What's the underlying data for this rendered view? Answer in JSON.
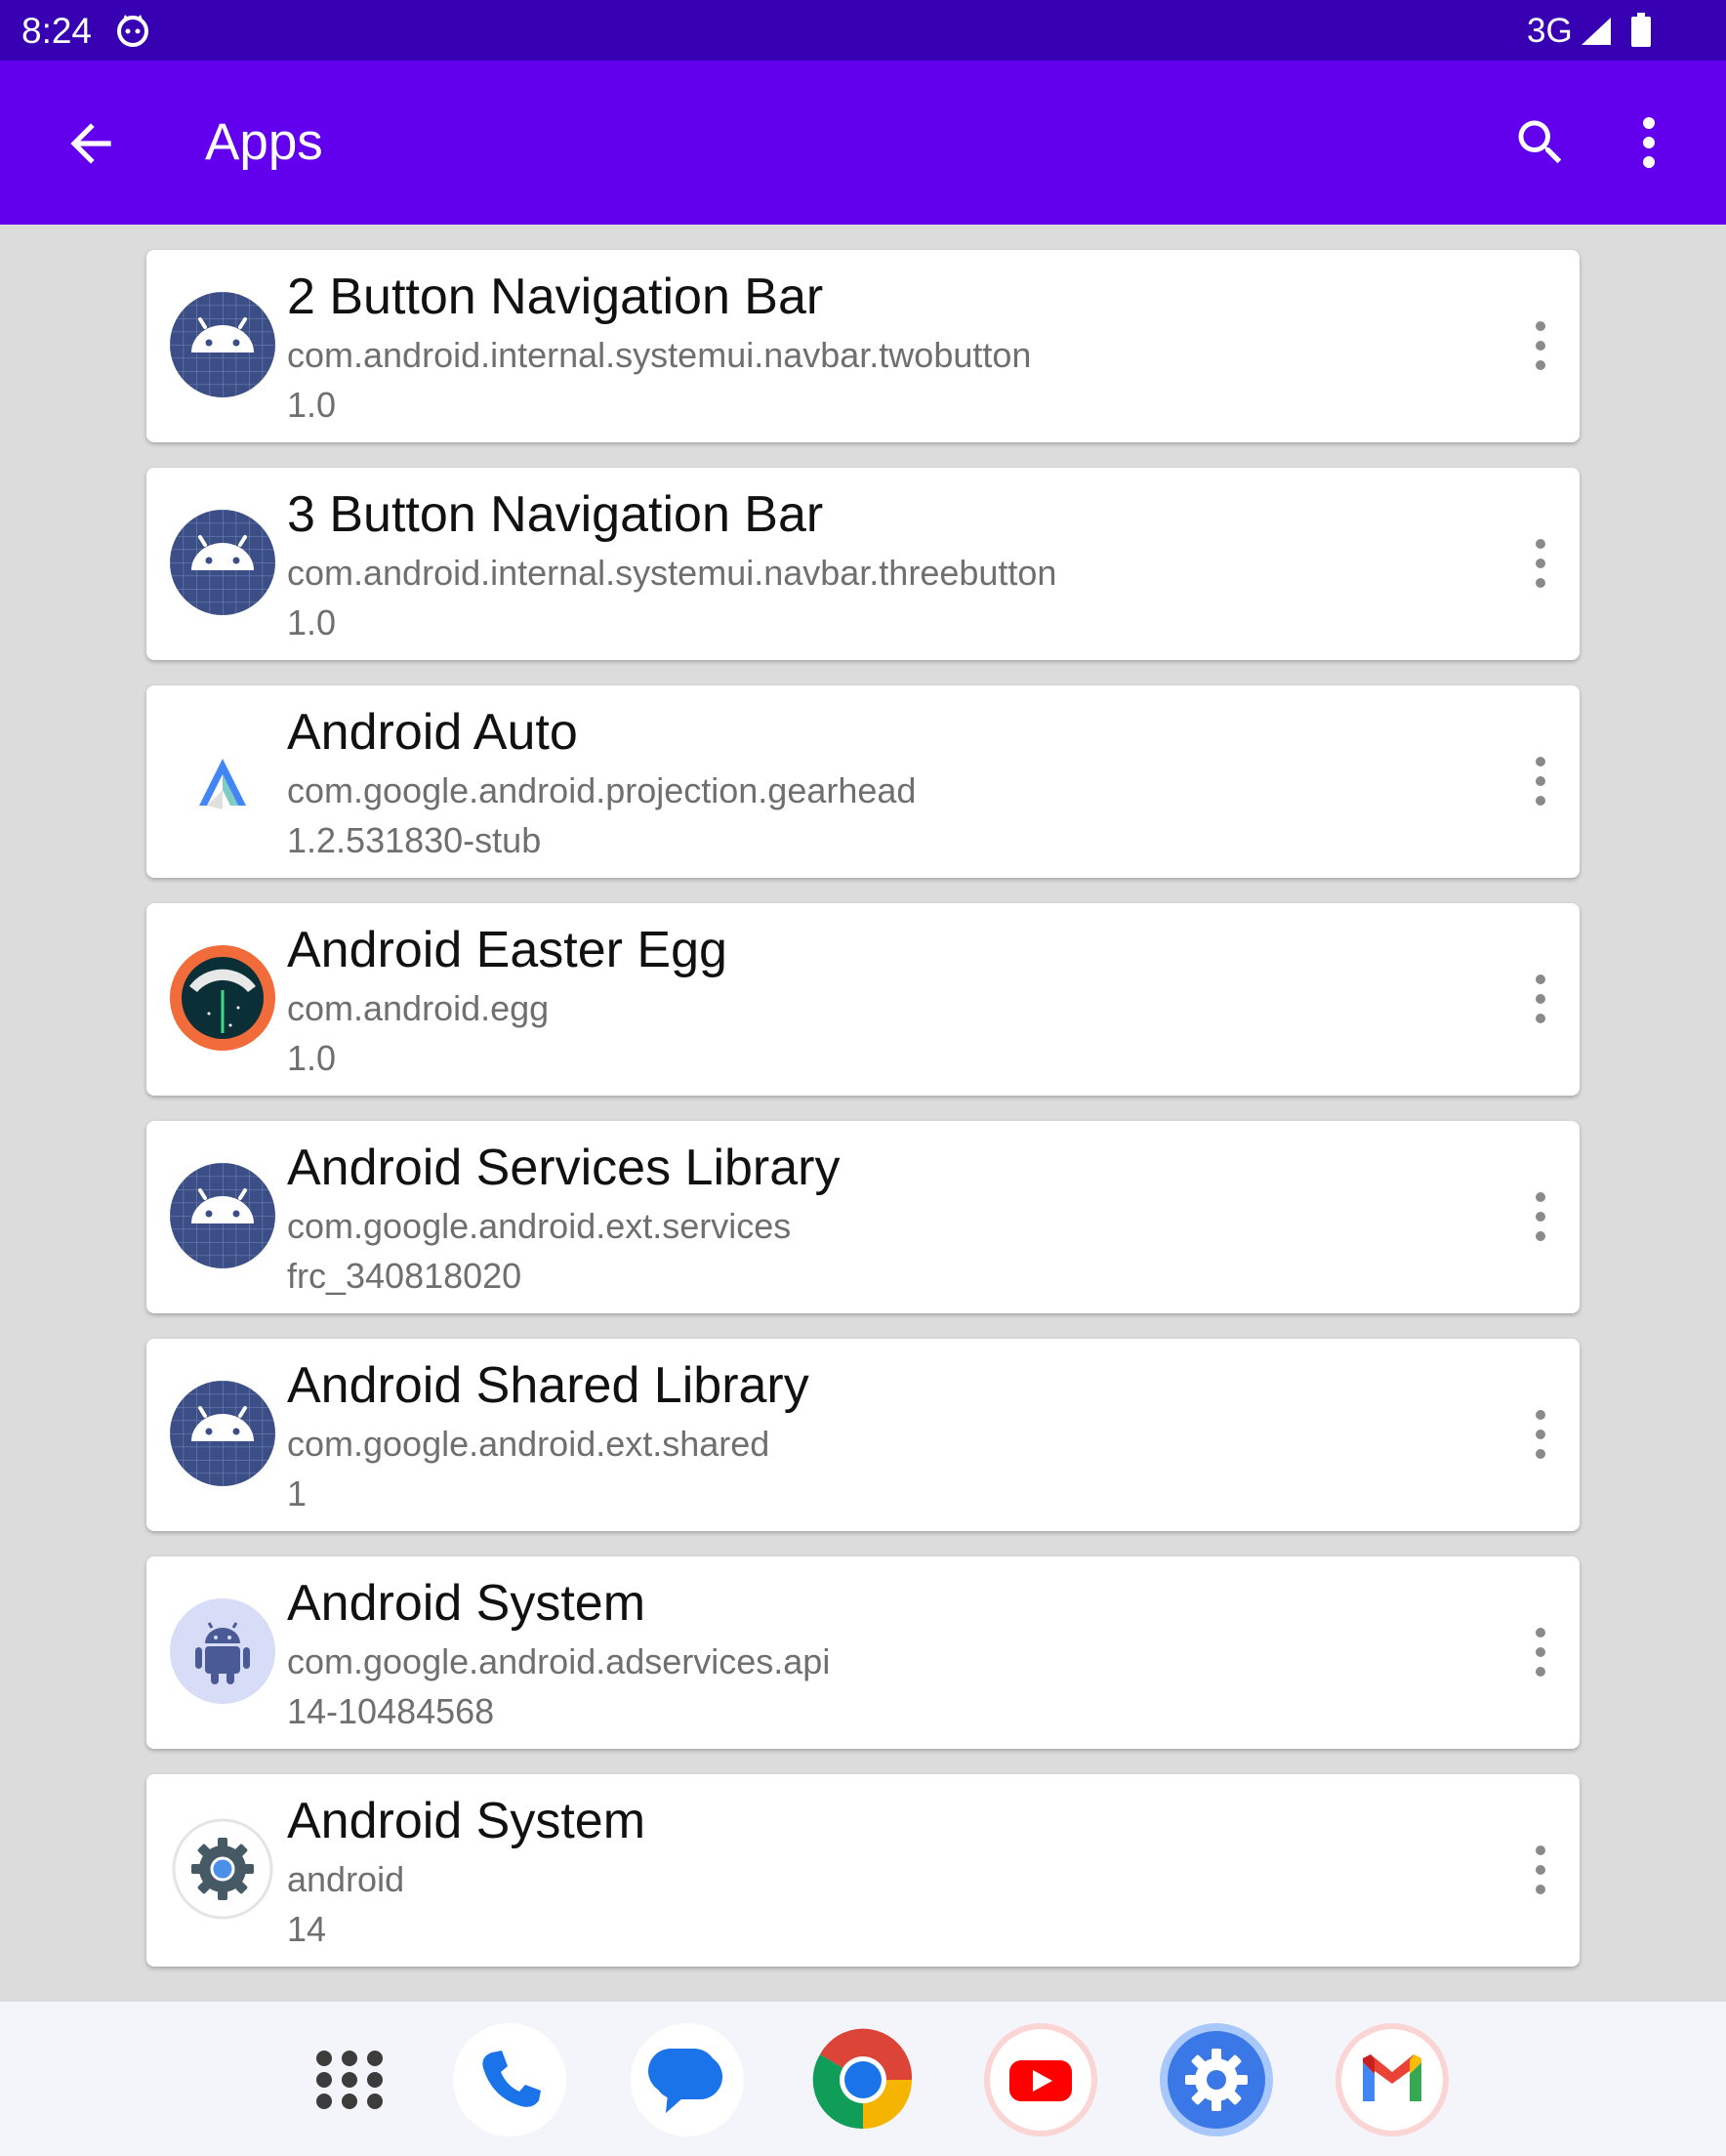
{
  "status_bar": {
    "time": "8:24",
    "network": "3G",
    "icons": [
      "cat-icon",
      "signal-icon",
      "battery-icon"
    ]
  },
  "app_bar": {
    "title": "Apps",
    "background": "#6200ee",
    "icons": [
      "back-arrow-icon",
      "search-icon",
      "more-vert-icon"
    ]
  },
  "apps": [
    {
      "name": "2 Button Navigation Bar",
      "package": "com.android.internal.systemui.navbar.twobutton",
      "version": "1.0",
      "icon": "android-default-icon"
    },
    {
      "name": "3 Button Navigation Bar",
      "package": "com.android.internal.systemui.navbar.threebutton",
      "version": "1.0",
      "icon": "android-default-icon"
    },
    {
      "name": "Android Auto",
      "package": "com.google.android.projection.gearhead",
      "version": "1.2.531830-stub",
      "icon": "android-auto-icon"
    },
    {
      "name": "Android Easter Egg",
      "package": "com.android.egg",
      "version": "1.0",
      "icon": "easter-egg-icon"
    },
    {
      "name": "Android Services Library",
      "package": "com.google.android.ext.services",
      "version": "frc_340818020",
      "icon": "android-default-icon"
    },
    {
      "name": "Android Shared Library",
      "package": "com.google.android.ext.shared",
      "version": "1",
      "icon": "android-default-icon"
    },
    {
      "name": "Android System",
      "package": "com.google.android.adservices.api",
      "version": "14-10484568",
      "icon": "android-robot-icon"
    },
    {
      "name": "Android System",
      "package": "android",
      "version": "14",
      "icon": "settings-gear-icon"
    }
  ],
  "dock": {
    "icons": [
      "app-drawer-icon",
      "phone-icon",
      "messages-icon",
      "chrome-icon",
      "youtube-icon",
      "settings-icon",
      "gmail-icon"
    ]
  }
}
